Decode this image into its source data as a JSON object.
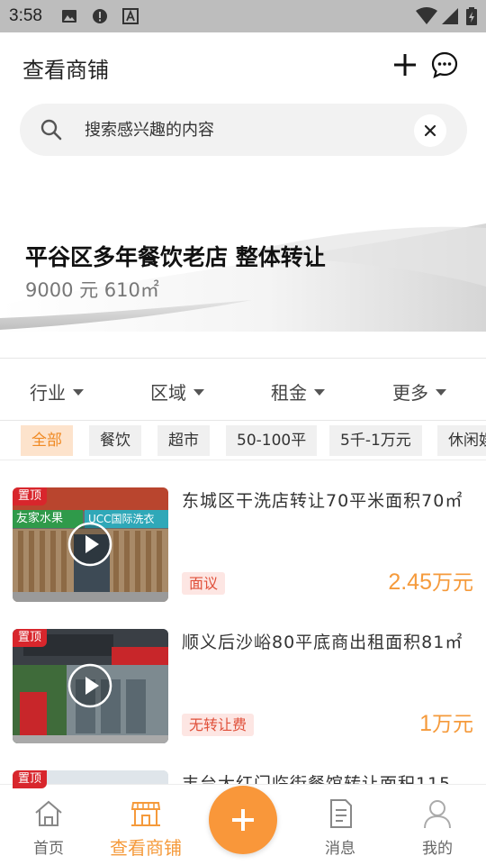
{
  "status_bar": {
    "time": "3:58"
  },
  "header": {
    "title": "查看商铺",
    "add_icon": "plus-icon",
    "chat_icon": "chat-bubble-icon"
  },
  "search": {
    "placeholder": "搜索感兴趣的内容"
  },
  "banner": {
    "title": "平谷区多年餐饮老店 整体转让",
    "subtitle": "9000 元 610㎡"
  },
  "filters": [
    {
      "label": "行业"
    },
    {
      "label": "区域"
    },
    {
      "label": "租金"
    },
    {
      "label": "更多"
    }
  ],
  "tags": [
    {
      "label": "全部",
      "active": true
    },
    {
      "label": "餐饮"
    },
    {
      "label": "超市"
    },
    {
      "label": "50-100平"
    },
    {
      "label": "5千-1万元"
    },
    {
      "label": "休闲娱"
    }
  ],
  "listings": [
    {
      "pin": "置顶",
      "title": "东城区干洗店转让70平米面积70㎡",
      "badge": "面议",
      "price_num": "2.45",
      "price_unit": "万元",
      "sign_left": "友家水果",
      "sign_right": "UCC国际洗衣"
    },
    {
      "pin": "置顶",
      "title": "顺义后沙峪80平底商出租面积81㎡",
      "badge": "无转让费",
      "price_num": "1",
      "price_unit": "万元"
    },
    {
      "pin": "置顶",
      "title": "丰台大红门临街餐馆转让面积115"
    }
  ],
  "tabbar": {
    "items": [
      {
        "label": "首页",
        "icon": "home-icon"
      },
      {
        "label": "查看商铺",
        "icon": "storefront-icon",
        "active": true
      },
      {
        "label": "消息",
        "icon": "document-icon"
      },
      {
        "label": "我的",
        "icon": "person-icon"
      }
    ],
    "fab_icon": "plus-icon"
  },
  "colors": {
    "accent": "#f59a3b",
    "pin_red": "#d8262c",
    "badge_text": "#e0503a"
  }
}
